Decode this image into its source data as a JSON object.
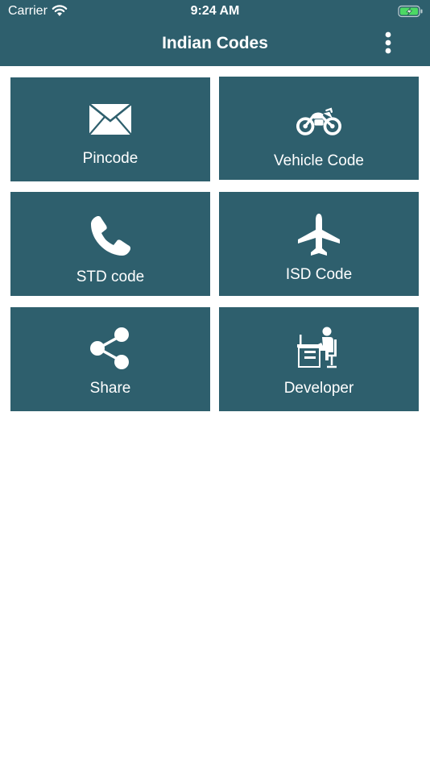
{
  "status_bar": {
    "carrier": "Carrier",
    "time": "9:24 AM",
    "battery_color": "#4cd964"
  },
  "nav": {
    "title": "Indian Codes",
    "menu_icon": "more-vertical-icon"
  },
  "theme": {
    "primary": "#2e5f6d",
    "background": "#ffffff",
    "text_on_primary": "#ffffff"
  },
  "tiles": [
    {
      "label": "Pincode",
      "icon": "envelope-icon"
    },
    {
      "label": "Vehicle Code",
      "icon": "motorcycle-icon"
    },
    {
      "label": "STD code",
      "icon": "phone-icon"
    },
    {
      "label": "ISD Code",
      "icon": "airplane-icon"
    },
    {
      "label": "Share",
      "icon": "share-icon"
    },
    {
      "label": "Developer",
      "icon": "developer-icon"
    }
  ]
}
